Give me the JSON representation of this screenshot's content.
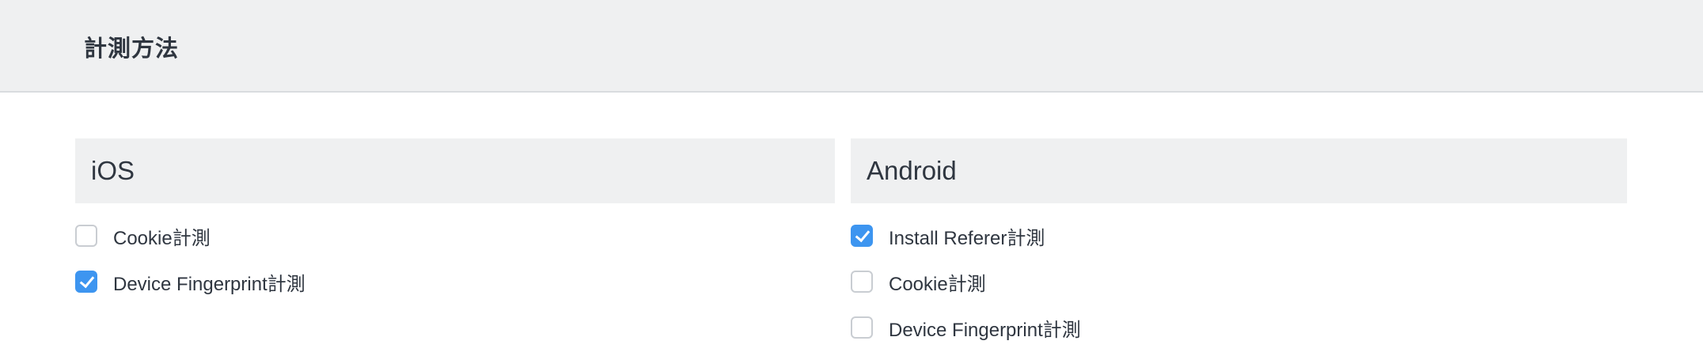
{
  "header": {
    "title": "計測方法"
  },
  "ios": {
    "title": "iOS",
    "options": [
      {
        "label": "Cookie計測",
        "checked": false
      },
      {
        "label": "Device Fingerprint計測",
        "checked": true
      }
    ]
  },
  "android": {
    "title": "Android",
    "options": [
      {
        "label": "Install Referer計測",
        "checked": true
      },
      {
        "label": "Cookie計測",
        "checked": false
      },
      {
        "label": "Device Fingerprint計測",
        "checked": false
      }
    ]
  },
  "colors": {
    "accent": "#3d95f0",
    "panel_background": "#eff0f1",
    "text": "#2f3640"
  }
}
